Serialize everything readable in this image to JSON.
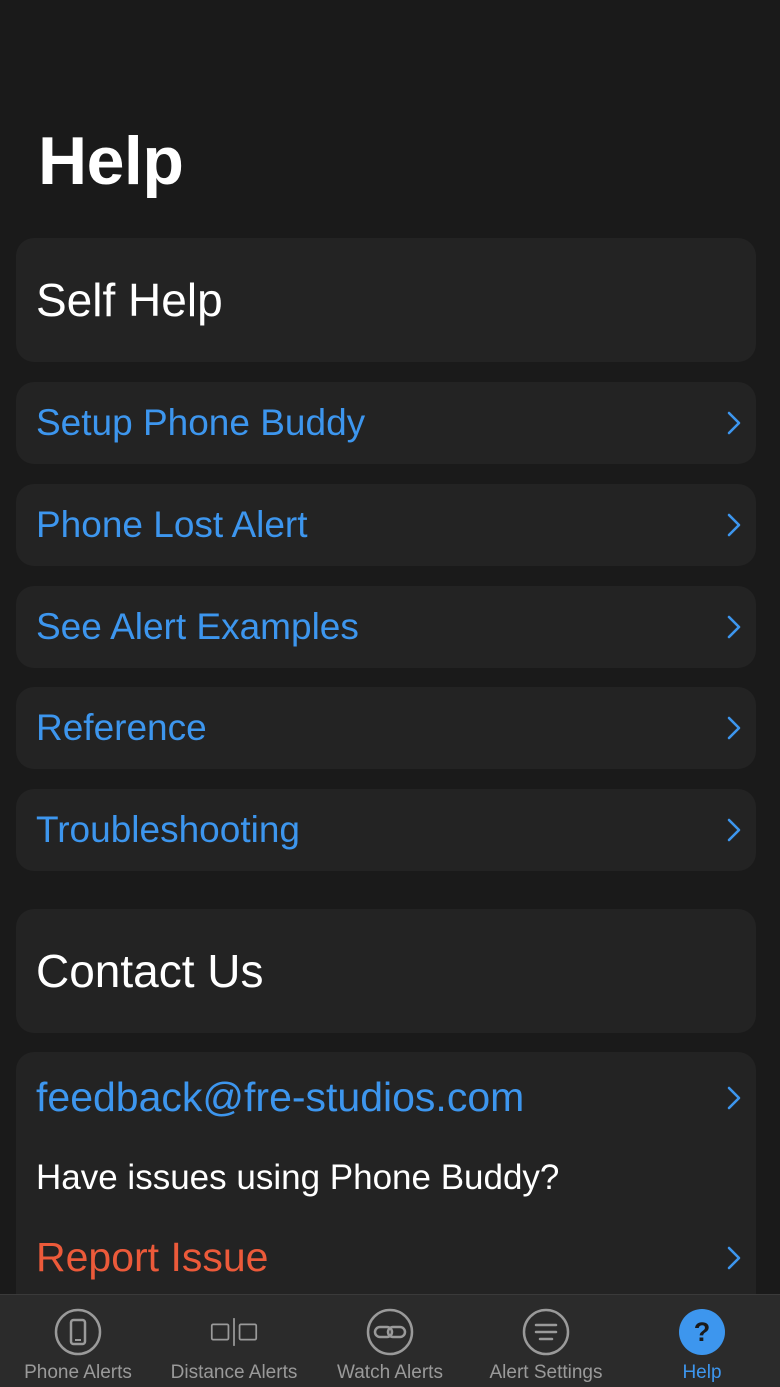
{
  "page": {
    "title": "Help"
  },
  "self_help": {
    "title": "Self Help",
    "items": [
      {
        "label": "Setup Phone Buddy"
      },
      {
        "label": "Phone Lost Alert"
      },
      {
        "label": "See Alert Examples"
      },
      {
        "label": "Reference"
      },
      {
        "label": "Troubleshooting"
      }
    ]
  },
  "contact": {
    "title": "Contact Us",
    "email": "feedback@fre-studios.com",
    "issue_text": "Have issues using Phone Buddy?",
    "report_label": "Report Issue"
  },
  "tabbar": {
    "tabs": [
      {
        "label": "Phone Alerts",
        "icon": "phone-icon"
      },
      {
        "label": "Distance Alerts",
        "icon": "distance-icon"
      },
      {
        "label": "Watch Alerts",
        "icon": "link-icon"
      },
      {
        "label": "Alert Settings",
        "icon": "settings-list-icon"
      },
      {
        "label": "Help",
        "icon": "help-icon"
      }
    ],
    "active": "Help"
  },
  "colors": {
    "background": "#1a1a1a",
    "card": "#232323",
    "accent": "#3d96ee",
    "danger": "#ec5a3a",
    "tab_inactive": "#9a9a9a"
  }
}
